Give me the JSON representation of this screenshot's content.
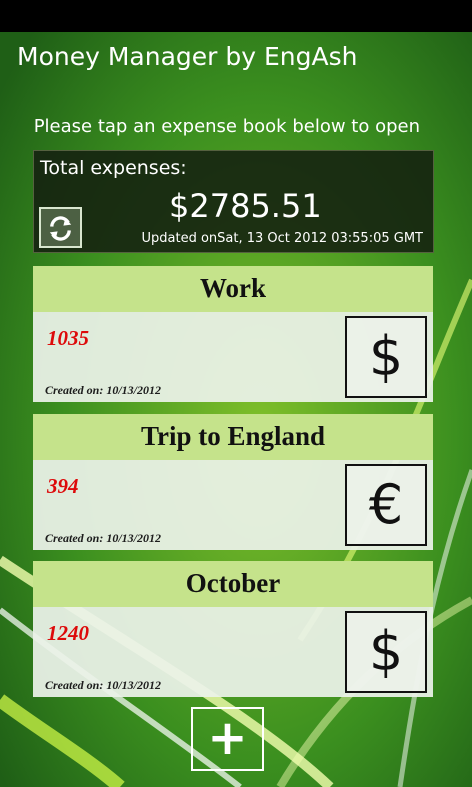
{
  "app": {
    "title": "Money Manager by EngAsh"
  },
  "instruction": "Please tap an expense book below to open",
  "summary": {
    "label": "Total expenses:",
    "amount": "$2785.51",
    "updated": "Updated onSat, 13 Oct 2012 03:55:05 GMT",
    "refresh_icon": "refresh-icon"
  },
  "books": [
    {
      "name": "Work",
      "amount": "1035",
      "created": "Created on: 10/13/2012",
      "currency_symbol": "$"
    },
    {
      "name": "Trip to England",
      "amount": "394",
      "created": "Created on: 10/13/2012",
      "currency_symbol": "€"
    },
    {
      "name": "October",
      "amount": "1240",
      "created": "Created on: 10/13/2012",
      "currency_symbol": "$"
    }
  ],
  "add_button": {
    "label": "+"
  },
  "colors": {
    "accent": "#c5e38b",
    "amount": "#dd0a0a",
    "background": "#2f7d1c"
  }
}
